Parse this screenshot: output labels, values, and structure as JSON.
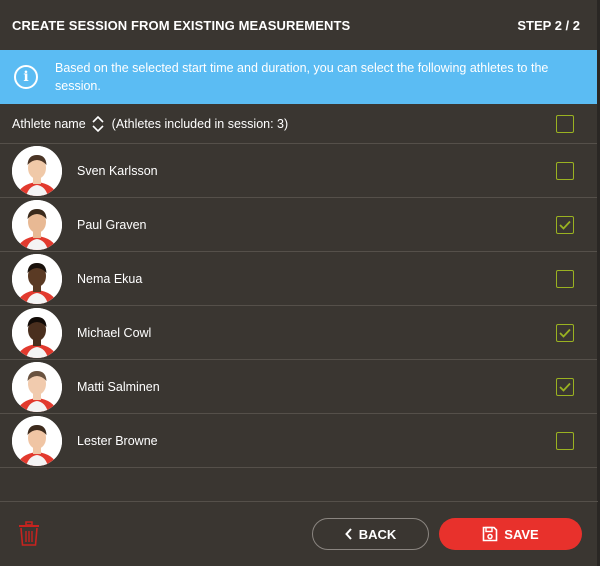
{
  "header": {
    "title": "CREATE SESSION FROM EXISTING MEASUREMENTS",
    "step": "STEP 2 / 2"
  },
  "info": {
    "icon": "info-icon",
    "message": "Based on the selected start time and duration, you can select the following athletes to the session."
  },
  "list_header": {
    "column": "Athlete name",
    "count_label": "(Athletes included in session: 3)",
    "all_checked": false
  },
  "athletes": [
    {
      "name": "Sven Karlsson",
      "checked": false
    },
    {
      "name": "Paul Graven",
      "checked": true
    },
    {
      "name": "Nema Ekua",
      "checked": false
    },
    {
      "name": "Michael Cowl",
      "checked": true
    },
    {
      "name": "Matti Salminen",
      "checked": true
    },
    {
      "name": "Lester Browne",
      "checked": false
    }
  ],
  "footer": {
    "back_label": "BACK",
    "save_label": "SAVE"
  },
  "colors": {
    "background": "#3a3631",
    "info": "#5bbcf3",
    "accent": "#9ab221",
    "save": "#e8312c"
  }
}
